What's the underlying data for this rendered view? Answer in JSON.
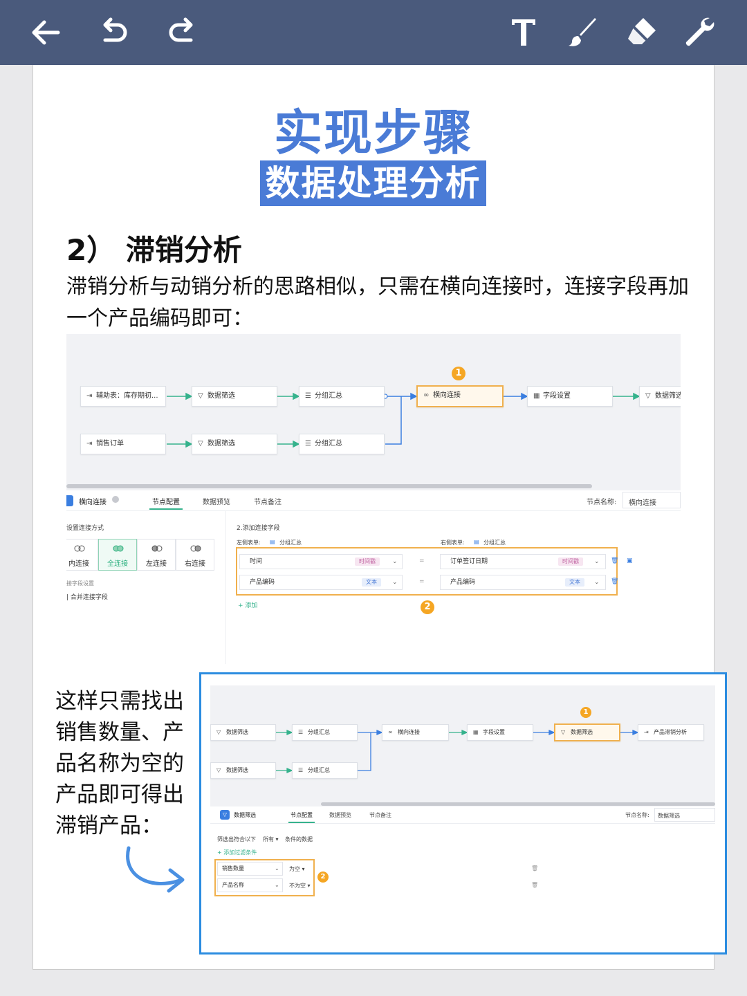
{
  "toolbar": {
    "icons": [
      "back-arrow-icon",
      "undo-icon",
      "redo-icon",
      "text-icon",
      "brush-icon",
      "eraser-icon",
      "wrench-icon"
    ]
  },
  "header": {
    "title": "实现步骤",
    "subtitle": "数据处理分析"
  },
  "section": {
    "heading": "2） 滞销分析",
    "paragraph": "滞销分析与动销分析的思路相似，只需在横向连接时，连接字段再加一个产品编码即可："
  },
  "shot1": {
    "nodes": {
      "n1": "辅助表：库存期初...",
      "n2": "数据筛选",
      "n3": "分组汇总",
      "n4": "横向连接",
      "n5": "字段设置",
      "n6": "数据筛选",
      "n7": "销售订单",
      "n8": "数据筛选",
      "n9": "分组汇总"
    },
    "badge1": "1",
    "badge2": "2",
    "tabs": {
      "node_title": "横向连接",
      "config": "节点配置",
      "preview": "数据预览",
      "note": "节点备注",
      "name_label": "节点名称:",
      "name_value": "横向连接"
    },
    "join": {
      "label": "设置连接方式",
      "inner": "内连接",
      "full": "全连接",
      "left": "左连接",
      "right": "右连接",
      "field_setting": "接字段设置",
      "merge": "合并连接字段"
    },
    "fields": {
      "label": "2.添加连接字段",
      "left_table_label": "左侧表单:",
      "left_table": "分组汇总",
      "right_table_label": "右侧表单:",
      "right_table": "分组汇总",
      "row1_left": "时间",
      "row1_left_tag": "时间戳",
      "row1_right": "订单签订日期",
      "row1_right_tag": "时间戳",
      "row2_left": "产品编码",
      "row2_left_tag": "文本",
      "row2_right": "产品编码",
      "row2_right_tag": "文本",
      "eq": "=",
      "add": "+ 添加"
    }
  },
  "side_text": "这样只需找出销售数量、产品名称为空的产品即可得出滞销产品：",
  "shot2": {
    "nodes": {
      "n1": "数据筛选",
      "n2": "分组汇总",
      "n3": "横向连接",
      "n4": "字段设置",
      "n5": "数据筛选",
      "n6": "产品滞销分析",
      "n7": "数据筛选",
      "n8": "分组汇总"
    },
    "badge1": "1",
    "badge2": "2",
    "tabs": {
      "node_title": "数据筛选",
      "config": "节点配置",
      "preview": "数据预览",
      "note": "节点备注",
      "name_label": "节点名称:",
      "name_value": "数据筛选"
    },
    "filter": {
      "prefix": "筛选出符合以下",
      "mode": "所有",
      "suffix": "条件的数据",
      "add": "+ 添加过滤条件",
      "row1_field": "销售数量",
      "row1_op": "为空",
      "row2_field": "产品名称",
      "row2_op": "不为空"
    }
  },
  "colors": {
    "toolbar": "#4a5a7c",
    "title_blue": "#4a7bd6",
    "highlight_orange": "#f0b04d",
    "frame_blue": "#2b8ce0",
    "flow_green": "#35b28c",
    "flow_blue": "#3a7ee0"
  }
}
